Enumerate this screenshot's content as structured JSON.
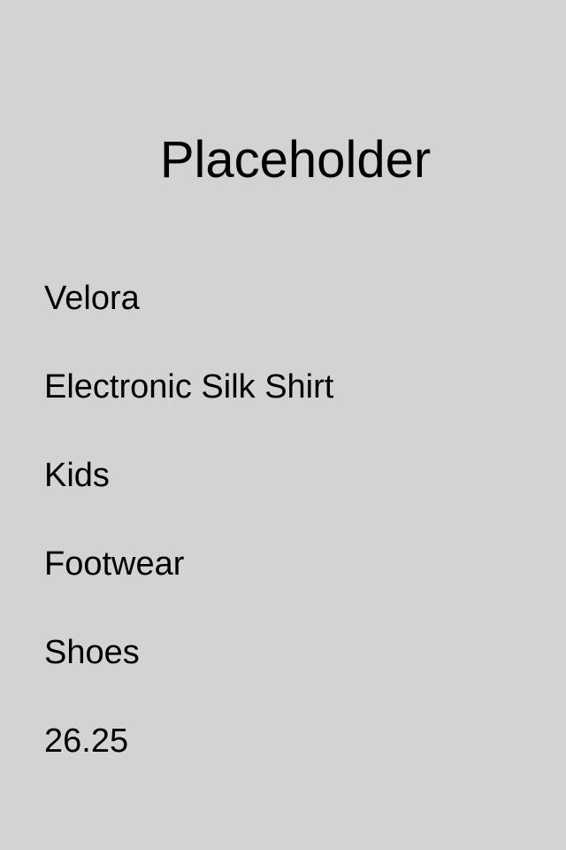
{
  "title": "Placeholder",
  "details": [
    "Velora",
    "Electronic Silk Shirt",
    "Kids",
    "Footwear",
    "Shoes",
    "26.25"
  ]
}
